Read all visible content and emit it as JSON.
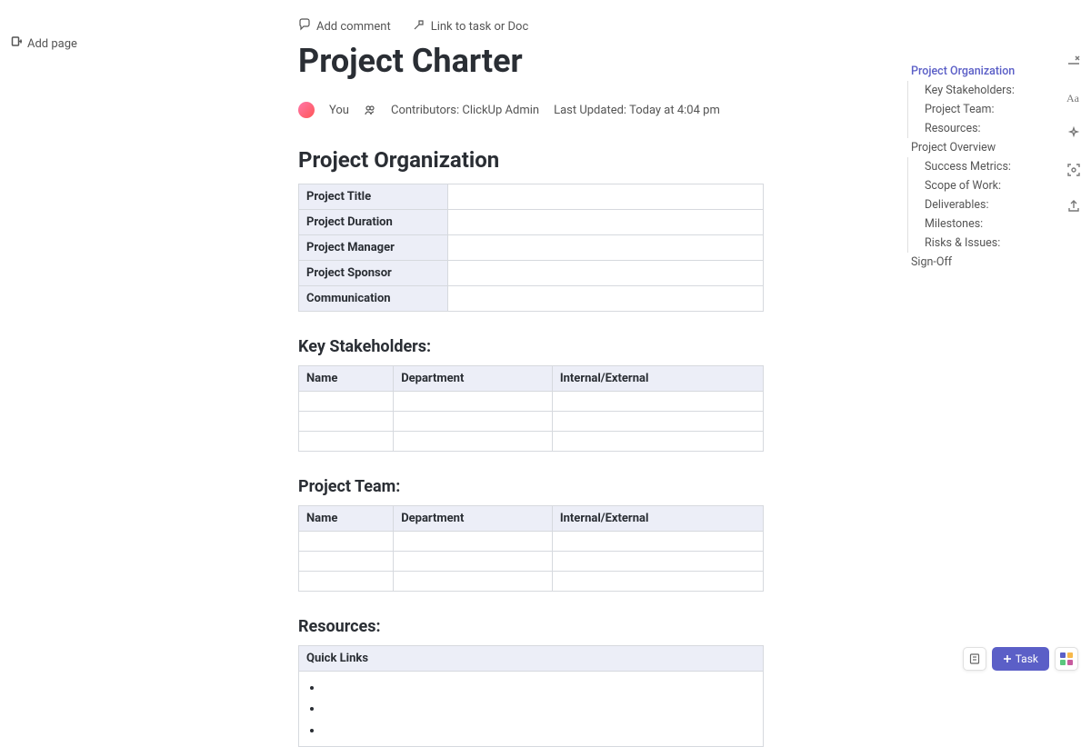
{
  "addPage": "Add page",
  "topActions": {
    "addComment": "Add comment",
    "linkTask": "Link to task or Doc"
  },
  "title": "Project Charter",
  "meta": {
    "you": "You",
    "contributorsLabel": "Contributors:",
    "contributorsValue": "ClickUp Admin",
    "lastUpdatedLabel": "Last Updated:",
    "lastUpdatedValue": "Today at 4:04 pm"
  },
  "sections": {
    "orgHeading": "Project Organization",
    "orgRows": [
      "Project Title",
      "Project Duration",
      "Project Manager",
      "Project Sponsor",
      "Communication"
    ],
    "stakeholdersHeading": "Key Stakeholders:",
    "stakeholdersCols": [
      "Name",
      "Department",
      "Internal/External"
    ],
    "teamHeading": "Project Team:",
    "teamCols": [
      "Name",
      "Department",
      "Internal/External"
    ],
    "resourcesHeading": "Resources:",
    "resourcesCols": [
      "Quick Links"
    ]
  },
  "outline": [
    {
      "label": "Project Organization",
      "level": 0,
      "active": true
    },
    {
      "label": "Key Stakeholders:",
      "level": 1,
      "active": false
    },
    {
      "label": "Project Team:",
      "level": 1,
      "active": false
    },
    {
      "label": "Resources:",
      "level": 1,
      "active": false
    },
    {
      "label": "Project Overview",
      "level": 0,
      "active": false
    },
    {
      "label": "Success Metrics:",
      "level": 1,
      "active": false
    },
    {
      "label": "Scope of Work:",
      "level": 1,
      "active": false
    },
    {
      "label": "Deliverables:",
      "level": 1,
      "active": false
    },
    {
      "label": "Milestones:",
      "level": 1,
      "active": false
    },
    {
      "label": "Risks & Issues:",
      "level": 1,
      "active": false
    },
    {
      "label": "Sign-Off",
      "level": 0,
      "active": false
    }
  ],
  "bottom": {
    "taskLabel": "Task"
  }
}
